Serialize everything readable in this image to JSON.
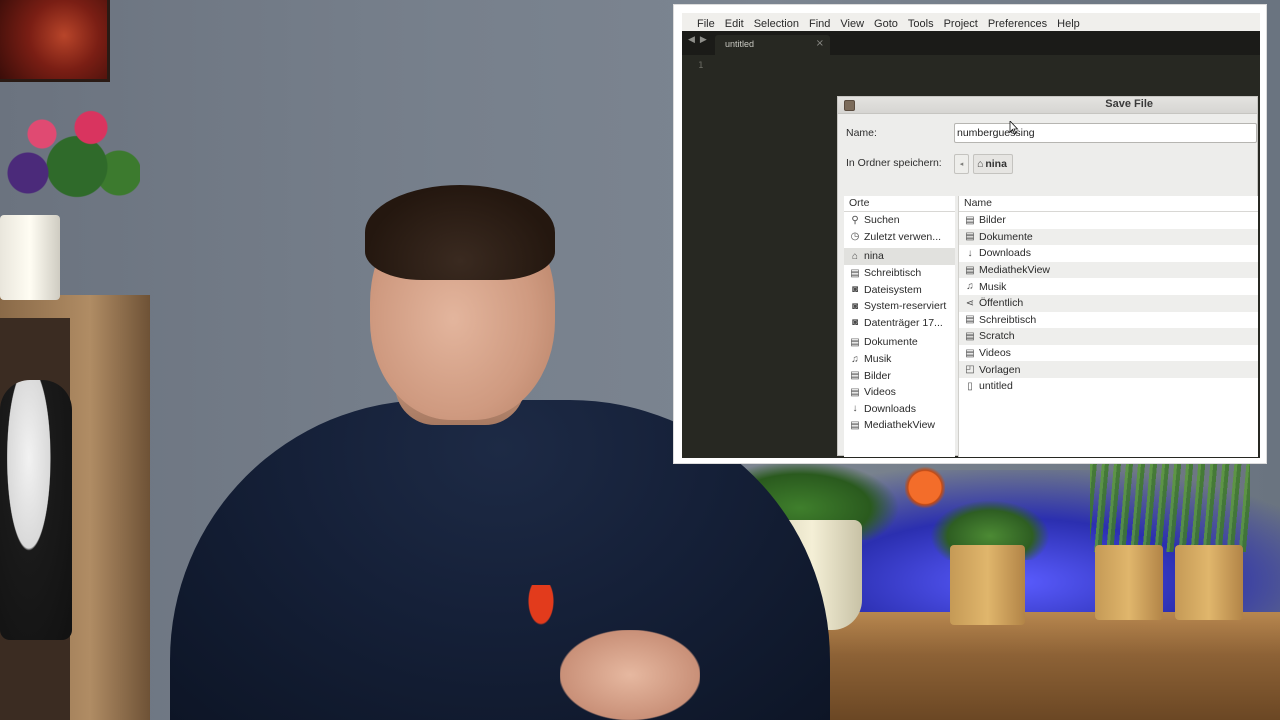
{
  "menubar": {
    "items": [
      {
        "label": "File"
      },
      {
        "label": "Edit"
      },
      {
        "label": "Selection"
      },
      {
        "label": "Find"
      },
      {
        "label": "View"
      },
      {
        "label": "Goto"
      },
      {
        "label": "Tools"
      },
      {
        "label": "Project"
      },
      {
        "label": "Preferences"
      },
      {
        "label": "Help"
      }
    ]
  },
  "editor": {
    "tab_label": "untitled",
    "tab_close": "×",
    "nav_arrows": "◀▶",
    "line_number": "1"
  },
  "dialog": {
    "title": "Save File",
    "name_label": "Name:",
    "name_value": "numberguessing",
    "folder_label": "In Ordner speichern:",
    "path_back": "◂",
    "path_current": "nina",
    "places_header": "Orte",
    "files_header": "Name",
    "places": [
      {
        "label": "Suchen",
        "icon": "search-icon",
        "glyph": "⚲"
      },
      {
        "label": "Zuletzt verwen...",
        "icon": "clock-icon",
        "glyph": "◷"
      },
      {
        "label": "nina",
        "icon": "home-icon",
        "glyph": "⌂",
        "selected": true
      },
      {
        "label": "Schreibtisch",
        "icon": "folder-icon",
        "glyph": "▤"
      },
      {
        "label": "Dateisystem",
        "icon": "drive-icon",
        "glyph": "◙"
      },
      {
        "label": "System-reserviert",
        "icon": "drive-icon",
        "glyph": "◙"
      },
      {
        "label": "Datenträger 17...",
        "icon": "drive-icon",
        "glyph": "◙"
      },
      {
        "label": "Dokumente",
        "icon": "folder-icon",
        "glyph": "▤"
      },
      {
        "label": "Musik",
        "icon": "music-icon",
        "glyph": "♫"
      },
      {
        "label": "Bilder",
        "icon": "folder-icon",
        "glyph": "▤"
      },
      {
        "label": "Videos",
        "icon": "folder-icon",
        "glyph": "▤"
      },
      {
        "label": "Downloads",
        "icon": "download-icon",
        "glyph": "↓"
      },
      {
        "label": "MediathekView",
        "icon": "folder-icon",
        "glyph": "▤"
      }
    ],
    "files": [
      {
        "label": "Bilder",
        "icon": "folder-icon",
        "glyph": "▤"
      },
      {
        "label": "Dokumente",
        "icon": "folder-icon",
        "glyph": "▤"
      },
      {
        "label": "Downloads",
        "icon": "download-icon",
        "glyph": "↓"
      },
      {
        "label": "MediathekView",
        "icon": "folder-icon",
        "glyph": "▤"
      },
      {
        "label": "Musik",
        "icon": "music-icon",
        "glyph": "♫"
      },
      {
        "label": "Öffentlich",
        "icon": "share-icon",
        "glyph": "⋖"
      },
      {
        "label": "Schreibtisch",
        "icon": "folder-icon",
        "glyph": "▤"
      },
      {
        "label": "Scratch",
        "icon": "folder-icon",
        "glyph": "▤"
      },
      {
        "label": "Videos",
        "icon": "folder-icon",
        "glyph": "▤"
      },
      {
        "label": "Vorlagen",
        "icon": "template-icon",
        "glyph": "◰"
      },
      {
        "label": "untitled",
        "icon": "document-icon",
        "glyph": "▯"
      }
    ]
  },
  "colors": {
    "editor_bg": "#272822",
    "dialog_bg": "#ededeb",
    "selected_row": "#e1e1de"
  }
}
